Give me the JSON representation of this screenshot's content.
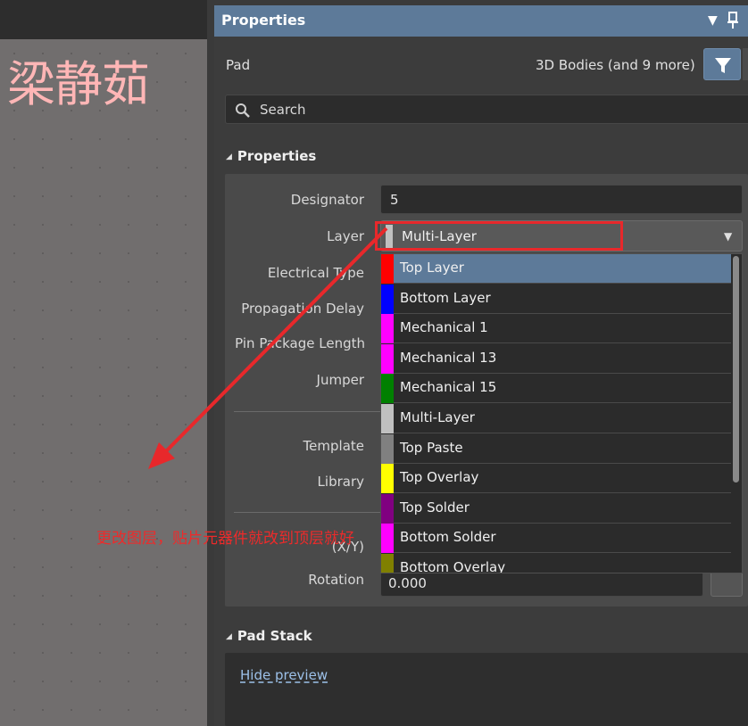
{
  "canvas": {
    "watermark": "梁静茹"
  },
  "panel": {
    "title": "Properties",
    "object_type": "Pad",
    "filter_summary": "3D Bodies (and 9 more)",
    "search_placeholder": "Search"
  },
  "properties_section": {
    "title": "Properties",
    "labels": {
      "designator": "Designator",
      "layer": "Layer",
      "electrical_type": "Electrical Type",
      "propagation_delay": "Propagation Delay",
      "pin_package_length": "Pin Package Length",
      "jumper": "Jumper",
      "template": "Template",
      "library": "Library",
      "xy": "(X/Y)",
      "rotation": "Rotation"
    },
    "designator_value": "5",
    "layer_value": "Multi-Layer",
    "rotation_value": "0.000"
  },
  "layer_dropdown": {
    "options": [
      {
        "label": "Top Layer",
        "color": "#ff0000",
        "selected": true
      },
      {
        "label": "Bottom Layer",
        "color": "#0000ff",
        "selected": false
      },
      {
        "label": "Mechanical 1",
        "color": "#ff00ff",
        "selected": false
      },
      {
        "label": "Mechanical 13",
        "color": "#ff00ff",
        "selected": false
      },
      {
        "label": "Mechanical 15",
        "color": "#008000",
        "selected": false
      },
      {
        "label": "Multi-Layer",
        "color": "#c0c0c0",
        "selected": false
      },
      {
        "label": "Top Paste",
        "color": "#808080",
        "selected": false
      },
      {
        "label": "Top Overlay",
        "color": "#ffff00",
        "selected": false
      },
      {
        "label": "Top Solder",
        "color": "#800080",
        "selected": false
      },
      {
        "label": "Bottom Solder",
        "color": "#ff00ff",
        "selected": false
      },
      {
        "label": "Bottom Overlay",
        "color": "#808000",
        "selected": false
      }
    ]
  },
  "pad_stack_section": {
    "title": "Pad Stack",
    "hide_preview": "Hide preview"
  },
  "annotation": {
    "text": "更改图层，贴片元器件就改到顶层就好",
    "color": "#ee2a2a"
  },
  "colors": {
    "accent": "#5d7a99",
    "multi_layer_swatch": "#c0c0c0"
  }
}
